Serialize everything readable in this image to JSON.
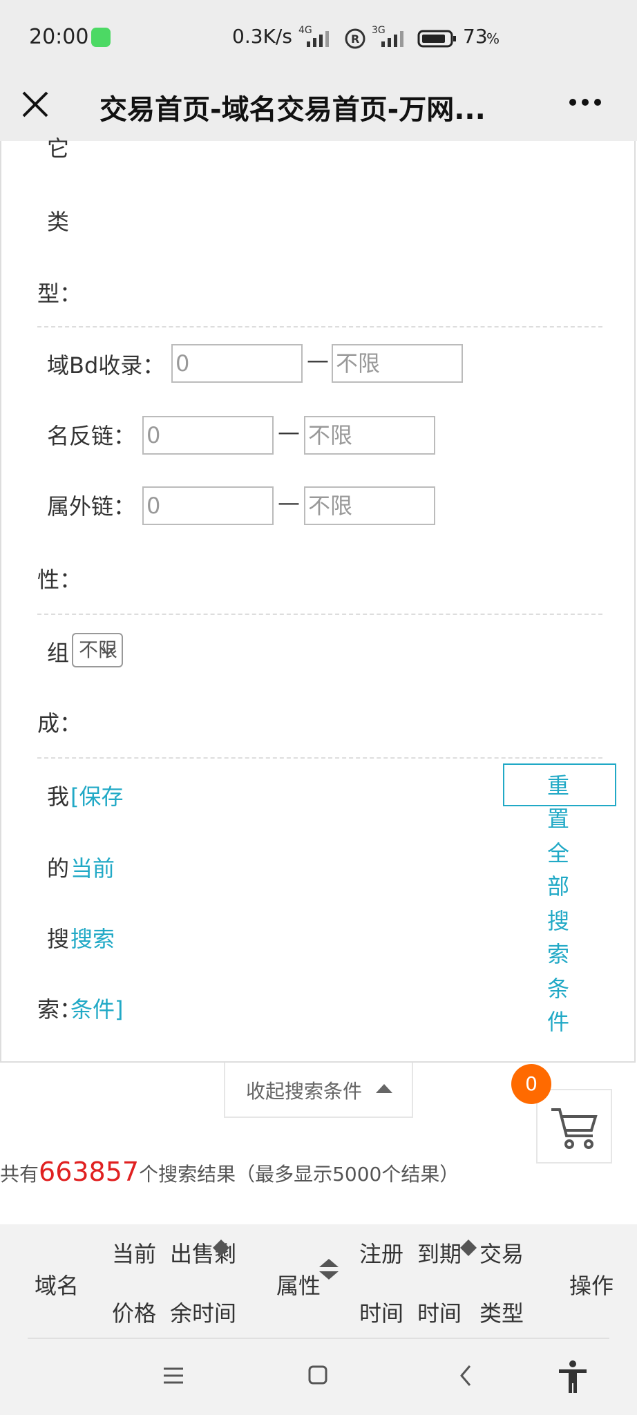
{
  "status_bar": {
    "time": "20:00",
    "network_speed": "0.3K/s",
    "signal_1": "4G",
    "signal_2": "3G",
    "battery": "73",
    "battery_unit": "%"
  },
  "title_bar": {
    "title": "交易首页-域名交易首页-万网...",
    "close_icon": "close-icon",
    "more_icon": "more-icon"
  },
  "form": {
    "other_type_label": {
      "line1": "它",
      "line2": "类",
      "line3": "型："
    },
    "bd_index_label": "域Bd收录：",
    "backlink_label": "名反链：",
    "external_link_label": "属外链：",
    "attribute_label_end": "性：",
    "bd_index_min": "0",
    "bd_index_max_placeholder": "不限",
    "backlink_min": "0",
    "backlink_max_placeholder": "不限",
    "external_min": "0",
    "external_max_placeholder": "不限",
    "range_sep": "—",
    "composition_label_1": "组",
    "composition_label_2": "成：",
    "composition_select": "不限",
    "my_search_labels": [
      "我",
      "的",
      "搜",
      "索："
    ],
    "save_link_parts": [
      "[保存",
      "当前",
      "搜索",
      "条件]"
    ],
    "reset_chars": [
      "重",
      "置",
      "全",
      "部",
      "搜",
      "索",
      "条",
      "件"
    ]
  },
  "collapse_button": "收起搜索条件",
  "cart": {
    "count": "0"
  },
  "results": {
    "prefix": "共有",
    "count": "663857",
    "suffix": "个搜索结果（最多显示5000个结果）"
  },
  "table_header": {
    "domain": "域名",
    "price_1": "当前",
    "price_2": "价格",
    "remaining_1": "出售剩",
    "remaining_2": "余时间",
    "attributes": "属性",
    "reg_1": "注册",
    "reg_2": "时间",
    "expire_1": "到期",
    "expire_2": "时间",
    "type_1": "交易",
    "type_2": "类型",
    "action": "操作"
  },
  "colors": {
    "link": "#21a9c6",
    "accent_orange": "#ff6a00",
    "count_red": "#e02020"
  }
}
